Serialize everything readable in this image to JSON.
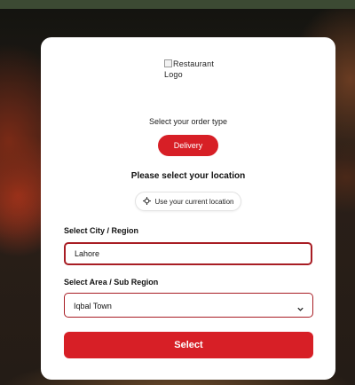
{
  "logo": {
    "alt_text": "Restaurant Logo"
  },
  "order_type": {
    "label": "Select your order type",
    "delivery_label": "Delivery"
  },
  "location": {
    "heading": "Please select your location",
    "current_location_label": "Use your current location"
  },
  "city": {
    "label": "Select City / Region",
    "value": "Lahore"
  },
  "area": {
    "label": "Select Area / Sub Region",
    "value": "Iqbal Town"
  },
  "submit": {
    "label": "Select"
  },
  "colors": {
    "accent": "#d71f26",
    "border_accent": "#a81d24",
    "stripe": "#3c4a33"
  },
  "icons": {
    "current_location": "crosshair-icon",
    "area_dropdown": "chevron-down-icon",
    "logo_placeholder": "broken-image-icon"
  }
}
